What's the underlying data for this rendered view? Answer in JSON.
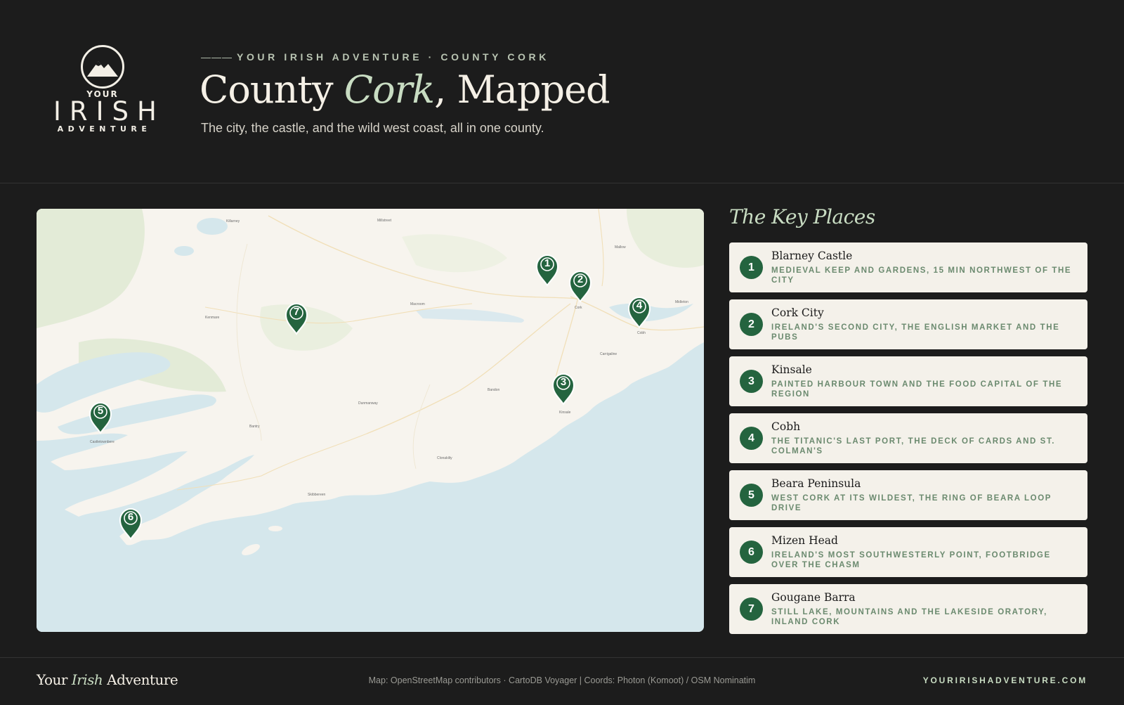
{
  "logo": {
    "line1": "YOUR",
    "line2": "IRISH",
    "line3": "ADVENTURE"
  },
  "header": {
    "eyebrow_dash": "———",
    "eyebrow": "YOUR IRISH ADVENTURE · COUNTY CORK",
    "title_before": "County ",
    "title_accent": "Cork",
    "title_after": ", Mapped",
    "subtitle": "The city, the castle, and the wild west coast, all in one county."
  },
  "map": {
    "pins": [
      "1",
      "2",
      "3",
      "4",
      "5",
      "6",
      "7"
    ],
    "labels": [
      "Killarney",
      "Millstreet",
      "Kenmare",
      "Macroom",
      "Mallow",
      "Cork",
      "Cobh",
      "Bandon",
      "Kinsale",
      "Dunmanway",
      "Bantry",
      "Clonakilty",
      "Skibbereen",
      "Castletownbere",
      "Carrigaline",
      "Midleton"
    ]
  },
  "panel": {
    "title": "The Key Places",
    "places": [
      {
        "num": "1",
        "name": "Blarney Castle",
        "desc": "Medieval keep and gardens, 15 min northwest of the city"
      },
      {
        "num": "2",
        "name": "Cork City",
        "desc": "Ireland's second city, the English Market and the pubs"
      },
      {
        "num": "3",
        "name": "Kinsale",
        "desc": "Painted harbour town and the food capital of the region"
      },
      {
        "num": "4",
        "name": "Cobh",
        "desc": "The Titanic's last port, the Deck of Cards and St. Colman's"
      },
      {
        "num": "5",
        "name": "Beara Peninsula",
        "desc": "West Cork at its wildest, the Ring of Beara loop drive"
      },
      {
        "num": "6",
        "name": "Mizen Head",
        "desc": "Ireland's most southwesterly point, footbridge over the chasm"
      },
      {
        "num": "7",
        "name": "Gougane Barra",
        "desc": "Still lake, mountains and the lakeside oratory, inland Cork"
      }
    ]
  },
  "footer": {
    "brand_before": "Your ",
    "brand_accent": "Irish",
    "brand_after": " Adventure",
    "credits": "Map: OpenStreetMap contributors · CartoDB Voyager | Coords: Photon (Komoot) / OSM Nominatim",
    "site": "YOURIRISHADVENTURE.COM"
  },
  "colors": {
    "background": "#1c1c1c",
    "accent": "#c8dcc2",
    "pin": "#24643f",
    "card": "#f4f1ea"
  }
}
